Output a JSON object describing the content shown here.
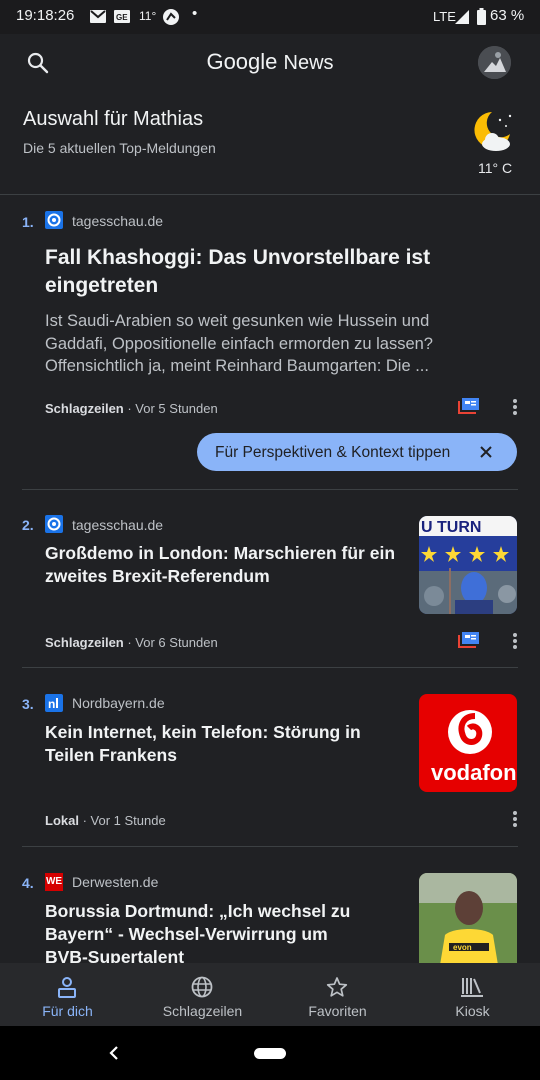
{
  "status_bar": {
    "time": "19:18:26",
    "temp": "11°",
    "dot": "•",
    "network": "LTE",
    "battery": "63 %"
  },
  "app_bar": {
    "title_google": "Google",
    "title_news": "News"
  },
  "header": {
    "title": "Auswahl für Mathias",
    "subtitle": "Die 5 aktuellen Top-Meldungen",
    "weather_temp": "11° C"
  },
  "articles": [
    {
      "index": "1.",
      "source": "tagesschau.de",
      "headline": "Fall Khashoggi: Das Unvorstellbare ist eingetreten",
      "snippet": "Ist Saudi-Arabien so weit gesunken wie Hussein und Gaddafi, Oppositionelle einfach ermorden zu lassen? Offensichtlich ja, meint Reinhard Baumgarten: Die ...",
      "section": "Schlagzeilen",
      "time": " · Vor 5 Stunden"
    },
    {
      "index": "2.",
      "source": "tagesschau.de",
      "headline": "Großdemo in London: Marschieren für ein zweites Brexit-Referendum",
      "section": "Schlagzeilen",
      "time": " · Vor 6 Stunden",
      "thumb_text": "U TURN"
    },
    {
      "index": "3.",
      "source": "Nordbayern.de",
      "headline": "Kein Internet, kein Telefon: Störung in Teilen Frankens",
      "section": "Lokal",
      "time": " · Vor 1 Stunde",
      "thumb_text": "vodafon"
    },
    {
      "index": "4.",
      "source": "Derwesten.de",
      "source_badge": "WE",
      "headline": "Borussia Dortmund: „Ich wechsel zu Bayern“ - Wechsel-Verwirrung um BVB-Supertalent",
      "thumb_text": "evon"
    }
  ],
  "tooltip": {
    "label": "Für Perspektiven & Kontext tippen"
  },
  "bottom_nav": [
    {
      "label": "Für dich",
      "icon": "person-icon",
      "active": true
    },
    {
      "label": "Schlagzeilen",
      "icon": "globe-icon",
      "active": false
    },
    {
      "label": "Favoriten",
      "icon": "star-icon",
      "active": false
    },
    {
      "label": "Kiosk",
      "icon": "kiosk-icon",
      "active": false
    }
  ],
  "colors": {
    "background": "#202124",
    "accent": "#8ab4f8",
    "text_primary": "#f1f3f4",
    "text_secondary": "#bdc1c6"
  }
}
